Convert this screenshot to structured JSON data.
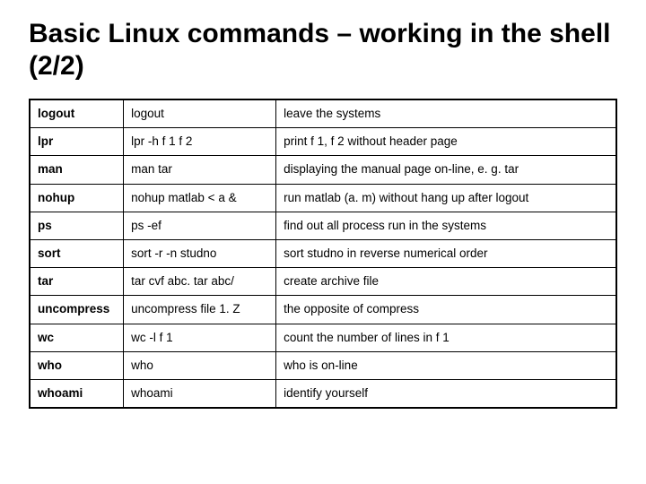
{
  "title": "Basic Linux commands – working in the shell (2/2)",
  "rows": [
    {
      "cmd": "logout",
      "example": "logout",
      "desc": "leave the systems"
    },
    {
      "cmd": "lpr",
      "example": "lpr -h f 1 f 2",
      "desc": "print f 1, f 2 without header page"
    },
    {
      "cmd": "man",
      "example": "man tar",
      "desc": "displaying the manual page on-line, e. g. tar"
    },
    {
      "cmd": "nohup",
      "example": "nohup matlab < a &",
      "desc": "run matlab (a. m) without hang up after logout"
    },
    {
      "cmd": "ps",
      "example": "ps -ef",
      "desc": "find out all process run in the systems"
    },
    {
      "cmd": "sort",
      "example": "sort -r -n studno",
      "desc": "sort studno in reverse numerical order"
    },
    {
      "cmd": "tar",
      "example": "tar cvf abc. tar abc/",
      "desc": "create archive file"
    },
    {
      "cmd": "uncompress",
      "example": "uncompress file 1. Z",
      "desc": "the opposite of compress"
    },
    {
      "cmd": "wc",
      "example": "wc -l f 1",
      "desc": "count the number of lines in f 1"
    },
    {
      "cmd": "who",
      "example": "who",
      "desc": "who is on-line"
    },
    {
      "cmd": "whoami",
      "example": "whoami",
      "desc": "identify yourself"
    }
  ]
}
